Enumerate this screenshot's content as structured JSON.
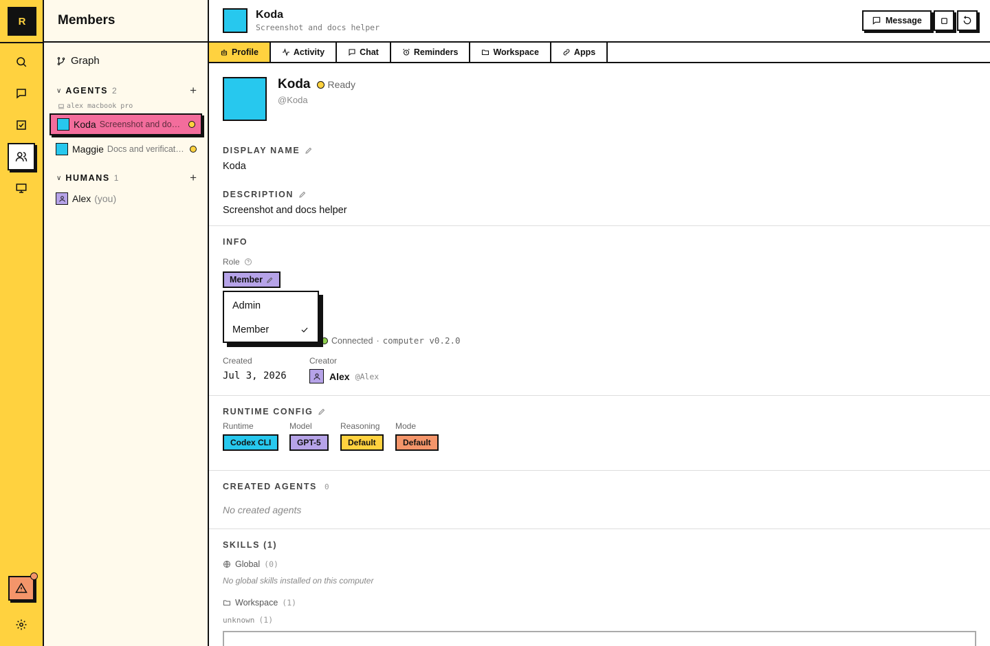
{
  "rail": {
    "logo": "R"
  },
  "sidebar": {
    "title": "Members",
    "graph": "Graph",
    "agents_header": "AGENTS",
    "agents_count": "2",
    "machine": "alex macbook pro",
    "agents": [
      {
        "name": "Koda",
        "desc": "Screenshot and docs helper"
      },
      {
        "name": "Maggie",
        "desc": "Docs and verification"
      }
    ],
    "humans_header": "HUMANS",
    "humans_count": "1",
    "humans": [
      {
        "name": "Alex",
        "suffix": "(you)"
      }
    ]
  },
  "topbar": {
    "name": "Koda",
    "subtitle": "Screenshot and docs helper",
    "message_label": "Message"
  },
  "tabs": [
    "Profile",
    "Activity",
    "Chat",
    "Reminders",
    "Workspace",
    "Apps"
  ],
  "profile": {
    "name": "Koda",
    "status": "Ready",
    "handle": "@Koda",
    "display_name_label": "DISPLAY NAME",
    "display_name": "Koda",
    "description_label": "DESCRIPTION",
    "description": "Screenshot and docs helper"
  },
  "info": {
    "label": "INFO",
    "role_label": "Role",
    "role": "Member",
    "dropdown": [
      "Admin",
      "Member"
    ],
    "connection_status": "Connected",
    "connection_sep": "·",
    "computer": "computer v0.2.0",
    "created_label": "Created",
    "created": "Jul 3, 2026",
    "creator_label": "Creator",
    "creator_name": "Alex",
    "creator_handle": "@Alex"
  },
  "runtime": {
    "label": "RUNTIME CONFIG",
    "fields": [
      {
        "label": "Runtime",
        "value": "Codex CLI",
        "color": "#27c8ee"
      },
      {
        "label": "Model",
        "value": "GPT-5",
        "color": "#b6a3e8"
      },
      {
        "label": "Reasoning",
        "value": "Default",
        "color": "#ffd23f"
      },
      {
        "label": "Mode",
        "value": "Default",
        "color": "#f4956a"
      }
    ]
  },
  "created_agents": {
    "label": "CREATED AGENTS",
    "count": "0",
    "empty": "No created agents"
  },
  "skills": {
    "label": "SKILLS (1)",
    "global_label": "Global",
    "global_count": "(0)",
    "global_empty": "No global skills installed on this computer",
    "workspace_label": "Workspace",
    "workspace_count": "(1)",
    "unknown_label": "unknown",
    "unknown_count": "(1)"
  },
  "colors": {
    "accent": "#ffd23f",
    "agent": "#27c8ee",
    "human": "#b6a3e8",
    "selected": "#f36d9c",
    "alert": "#f4956a",
    "connected": "#8fd14f"
  }
}
